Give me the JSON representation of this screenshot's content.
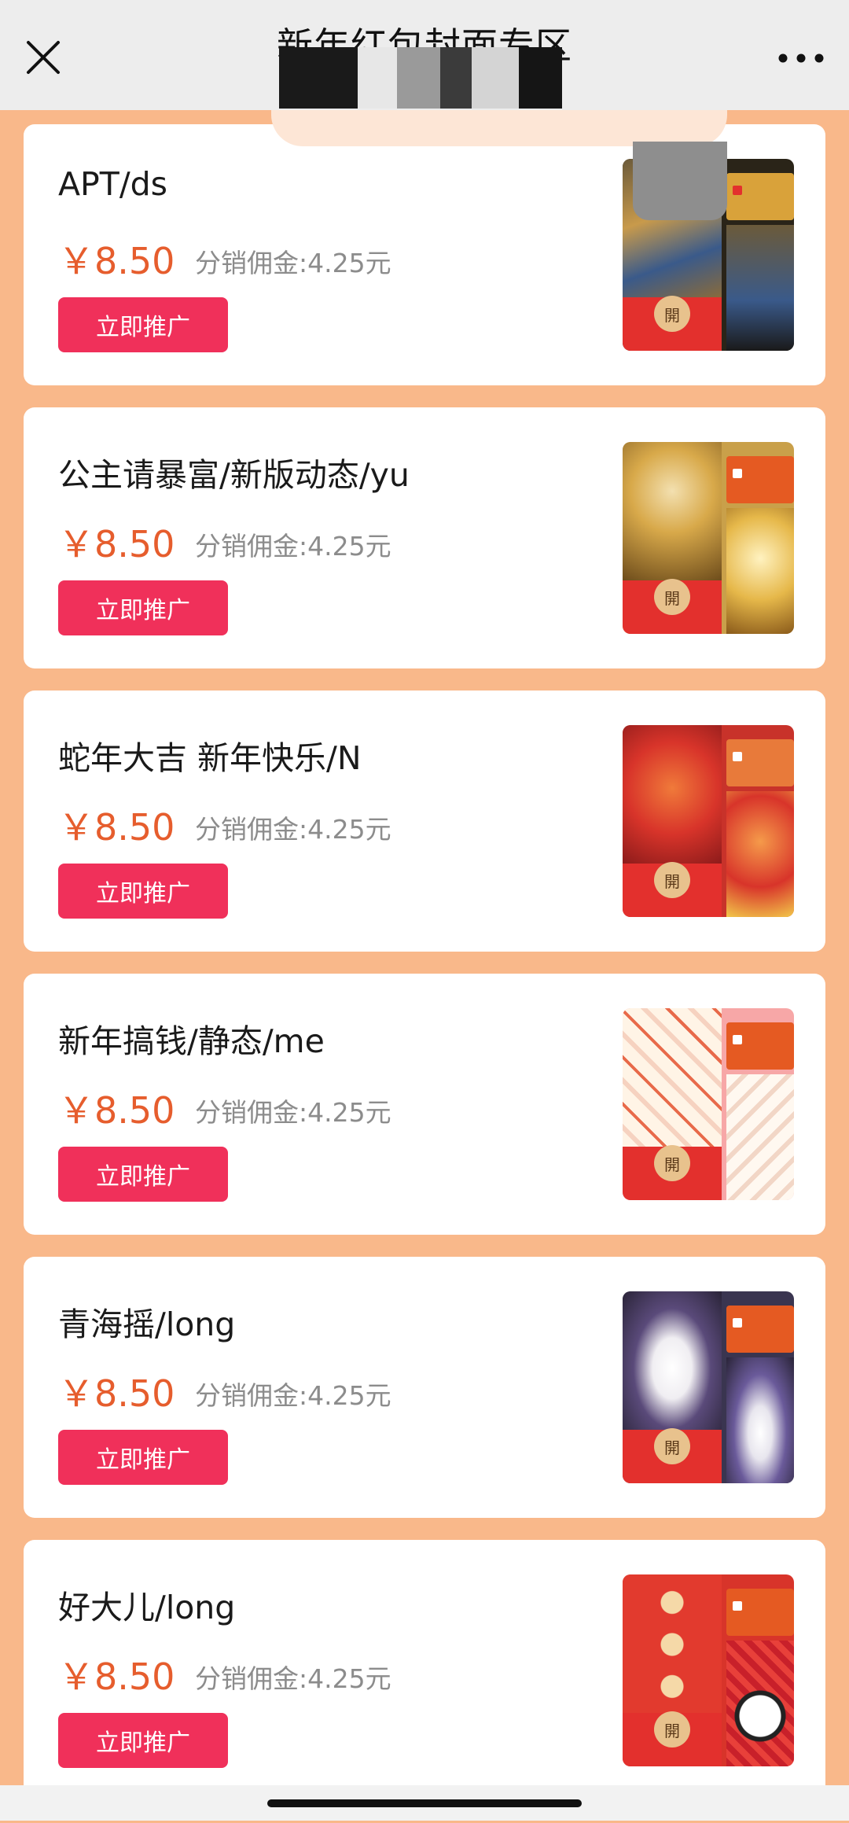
{
  "navbar": {
    "title": "新年红包封面专区"
  },
  "colors": {
    "page_bg": "#f9b88a",
    "price": "#e65d2d",
    "button": "#f0305a",
    "commission": "#8c8c8c"
  },
  "cards": [
    {
      "title": "APT/ds",
      "price": "￥8.50",
      "commission": "分销佣金:4.25元",
      "button": "立即推广",
      "thumb_open": "開",
      "thumb_theme": "cat-in-jacket"
    },
    {
      "title": "公主请暴富/新版动态/yu",
      "price": "￥8.50",
      "commission": "分销佣金:4.25元",
      "button": "立即推广",
      "thumb_open": "開",
      "thumb_theme": "golden-princess"
    },
    {
      "title": "蛇年大吉 新年快乐/N",
      "price": "￥8.50",
      "commission": "分销佣金:4.25元",
      "button": "立即推广",
      "thumb_open": "開",
      "thumb_theme": "red-snake-lion"
    },
    {
      "title": "新年搞钱/静态/me",
      "price": "￥8.50",
      "commission": "分销佣金:4.25元",
      "button": "立即推广",
      "thumb_open": "開",
      "thumb_theme": "cute-bunny-pattern"
    },
    {
      "title": "青海摇/long",
      "price": "￥8.50",
      "commission": "分销佣金:4.25元",
      "button": "立即推广",
      "thumb_open": "開",
      "thumb_theme": "dancing-dogs"
    },
    {
      "title": "好大儿/long",
      "price": "￥8.50",
      "commission": "分销佣金:4.25元",
      "button": "立即推广",
      "thumb_open": "開",
      "thumb_theme": "panda-red"
    }
  ]
}
